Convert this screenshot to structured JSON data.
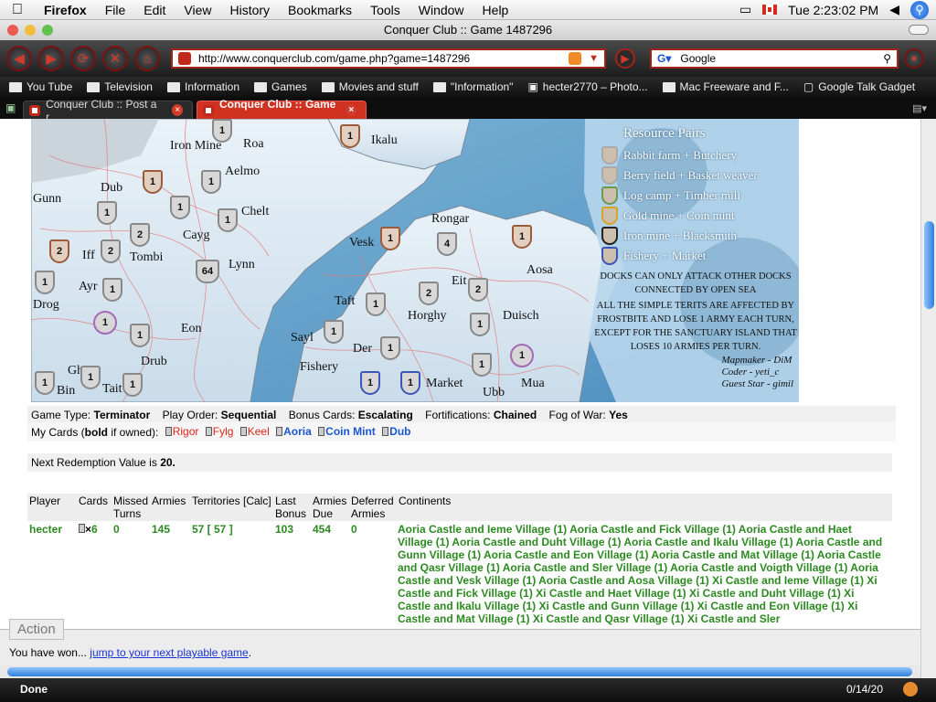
{
  "menubar": {
    "app": "Firefox",
    "items": [
      "File",
      "Edit",
      "View",
      "History",
      "Bookmarks",
      "Tools",
      "Window",
      "Help"
    ],
    "clock": "Tue 2:23:02 PM"
  },
  "window": {
    "title": "Conquer Club :: Game 1487296"
  },
  "nav": {
    "url": "http://www.conquerclub.com/game.php?game=1487296",
    "search_engine": "Google"
  },
  "bookmarks": [
    {
      "label": "You Tube",
      "icon": "folder-icon"
    },
    {
      "label": "Television",
      "icon": "folder-icon"
    },
    {
      "label": "Information",
      "icon": "folder-icon"
    },
    {
      "label": "Games",
      "icon": "folder-icon"
    },
    {
      "label": "Movies and stuff",
      "icon": "folder-icon"
    },
    {
      "label": "\"Information\"",
      "icon": "folder-icon"
    },
    {
      "label": "hecter2770 – Photo...",
      "icon": "camera-icon"
    },
    {
      "label": "Mac Freeware and F...",
      "icon": "folder-icon"
    },
    {
      "label": "Google Talk Gadget",
      "icon": "page-icon"
    }
  ],
  "tabs": [
    {
      "label": "Conquer Club :: Post a r...",
      "active": false
    },
    {
      "label": "Conquer Club :: Game ...",
      "active": true
    }
  ],
  "map": {
    "territories": [
      {
        "name": "Roa",
        "armies": "1"
      },
      {
        "name": "Ikalu",
        "armies": "1"
      },
      {
        "name": "Iron Mine",
        "armies": "1"
      },
      {
        "name": "Aelmo",
        "armies": "1"
      },
      {
        "name": "Dub",
        "armies": "1"
      },
      {
        "name": "Gunn",
        "armies": "1"
      },
      {
        "name": "Chelt",
        "armies": "1"
      },
      {
        "name": "Cayg",
        "armies": "2"
      },
      {
        "name": "Iff",
        "armies": "2"
      },
      {
        "name": "Tombi",
        "armies": "2"
      },
      {
        "name": "Lynn",
        "armies": "64"
      },
      {
        "name": "Ayr",
        "armies": "1"
      },
      {
        "name": "Drog",
        "armies": "1"
      },
      {
        "name": "Eon",
        "armies": "1"
      },
      {
        "name": "Drub",
        "armies": "1"
      },
      {
        "name": "Ghyr",
        "armies": "1"
      },
      {
        "name": "Bin",
        "armies": "1"
      },
      {
        "name": "Tait",
        "armies": "1"
      },
      {
        "name": "Rongar",
        "armies": "4"
      },
      {
        "name": "Vesk",
        "armies": "1"
      },
      {
        "name": "Aosa",
        "armies": "1"
      },
      {
        "name": "Eit",
        "armies": "2"
      },
      {
        "name": "Taft",
        "armies": "1"
      },
      {
        "name": "Horghy",
        "armies": "2"
      },
      {
        "name": "Duisch",
        "armies": "1"
      },
      {
        "name": "Sayl",
        "armies": "1"
      },
      {
        "name": "Der",
        "armies": "1"
      },
      {
        "name": "Fishery",
        "armies": "1"
      },
      {
        "name": "Market",
        "armies": "1"
      },
      {
        "name": "Ubb",
        "armies": "1"
      },
      {
        "name": "Mua",
        "armies": "1"
      }
    ],
    "resource_title": "Resource Pairs",
    "resource_pairs": [
      "Rabbit farm + Butchery",
      "Berry field + Basket weaver",
      "Log camp + Timber mill",
      "Gold mine + Coin mint",
      "Iron mine + Blacksmith",
      "Fishery + Market"
    ],
    "note1": "Docks can only attack other docks connected by open sea",
    "note2": "All the simple terits  are affected by frostbite and lose 1 army each turn, except for the sanctuary island that loses 10 armies per turn.",
    "credits": [
      "Mapmaker - DiM",
      "Coder - yeti_c",
      "Guest Star - gimil"
    ]
  },
  "game_info": {
    "type_label": "Game Type:",
    "type": "Terminator",
    "order_label": "Play Order:",
    "order": "Sequential",
    "bonus_label": "Bonus Cards:",
    "bonus": "Escalating",
    "fort_label": "Fortifications:",
    "fort": "Chained",
    "fog_label": "Fog of War:",
    "fog": "Yes"
  },
  "cards": {
    "label_pre": "My Cards (",
    "label_bold": "bold",
    "label_post": " if owned):",
    "list": [
      {
        "name": "Rigor",
        "owned": false
      },
      {
        "name": "Fylg",
        "owned": false
      },
      {
        "name": "Keel",
        "owned": false
      },
      {
        "name": "Aoria",
        "owned": true
      },
      {
        "name": "Coin Mint",
        "owned": true
      },
      {
        "name": "Dub",
        "owned": true
      }
    ]
  },
  "redemption": {
    "text": "Next Redemption Value is ",
    "value": "20."
  },
  "table": {
    "headers": [
      "Player",
      "Cards",
      "Missed Turns",
      "Armies",
      "Territories [Calc]",
      "Last Bonus",
      "Armies Due",
      "Deferred Armies",
      "Continents"
    ],
    "row": {
      "player": "hecter",
      "cards_mult": "×",
      "cards": "6",
      "missed": "0",
      "armies": "145",
      "territories": "57 [ 57 ]",
      "last_bonus": "103",
      "armies_due": "454",
      "deferred": "0",
      "continents": "Aoria Castle and Ieme Village (1) Aoria Castle and Fick Village (1) Aoria Castle and Haet Village (1) Aoria Castle and Duht Village (1) Aoria Castle and Ikalu Village (1) Aoria Castle and Gunn Village (1) Aoria Castle and Eon Village (1) Aoria Castle and Mat Village (1) Aoria Castle and Qasr Village (1) Aoria Castle and Sler Village (1) Aoria Castle and Voigth Village (1) Aoria Castle and Vesk Village (1) Aoria Castle and Aosa Village (1) Xi Castle and Ieme Village (1) Xi Castle and Fick Village (1) Xi Castle and Haet Village (1) Xi Castle and Duht Village (1) Xi Castle and Ikalu Village (1) Xi Castle and Gunn Village (1) Xi Castle and Eon Village (1) Xi Castle and Mat Village (1) Xi Castle and Qasr Village (1) Xi Castle and Sler"
    }
  },
  "action": {
    "legend": "Action",
    "msg": "You have won... ",
    "link": "jump to your next playable game",
    "period": "."
  },
  "status": {
    "left": "Done",
    "right": "0/14/20"
  }
}
